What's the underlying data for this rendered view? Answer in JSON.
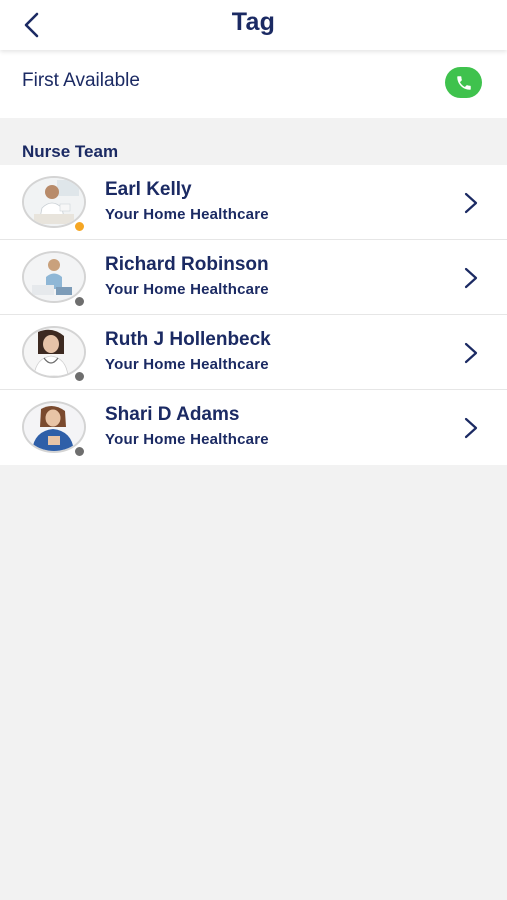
{
  "header": {
    "title": "Tag",
    "back_icon": "chevron-left-icon"
  },
  "first_available": {
    "label": "First Available",
    "call_icon": "phone-icon",
    "call_color": "#3fc24d"
  },
  "section": {
    "title": "Nurse Team"
  },
  "contacts": [
    {
      "name": "Earl Kelly",
      "organization": "Your Home Healthcare",
      "status": "away",
      "status_color": "#f5a623"
    },
    {
      "name": "Richard Robinson",
      "organization": "Your Home Healthcare",
      "status": "offline",
      "status_color": "#6e6e6e"
    },
    {
      "name": "Ruth J Hollenbeck",
      "organization": "Your Home Healthcare",
      "status": "offline",
      "status_color": "#6e6e6e"
    },
    {
      "name": "Shari D Adams",
      "organization": "Your Home Healthcare",
      "status": "offline",
      "status_color": "#6e6e6e"
    }
  ],
  "colors": {
    "text_primary": "#1b2a63",
    "background": "#f2f2f2",
    "surface": "#ffffff"
  }
}
